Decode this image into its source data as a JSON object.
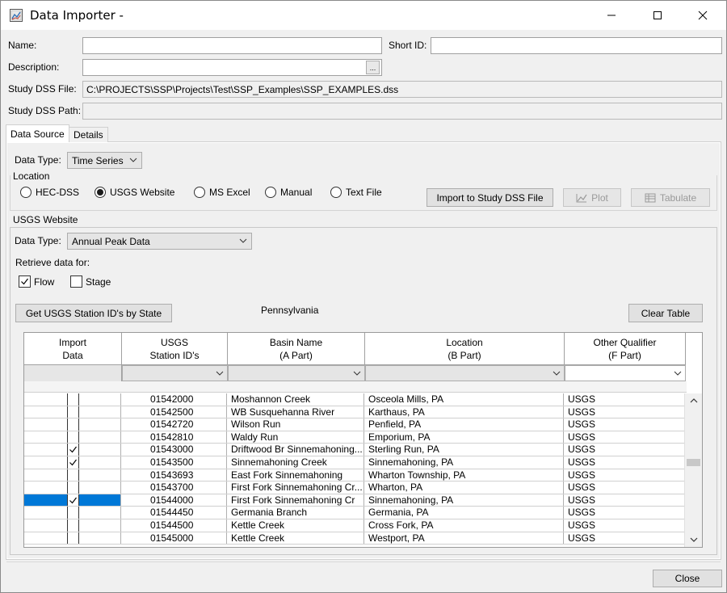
{
  "window": {
    "title": "Data Importer -"
  },
  "form": {
    "name_label": "Name:",
    "name_value": "",
    "short_id_label": "Short ID:",
    "short_id_value": "",
    "description_label": "Description:",
    "description_value": "",
    "browse_label": "...",
    "study_dss_file_label": "Study DSS File:",
    "study_dss_file_value": "C:\\PROJECTS\\SSP\\Projects\\Test\\SSP_Examples\\SSP_EXAMPLES.dss",
    "study_dss_path_label": "Study DSS Path:",
    "study_dss_path_value": ""
  },
  "tabs": [
    {
      "label": "Data Source",
      "selected": true
    },
    {
      "label": "Details",
      "selected": false
    }
  ],
  "data_source": {
    "data_type_label": "Data Type:",
    "data_type_value": "Time Series",
    "location_label": "Location",
    "radios": [
      {
        "label": "HEC-DSS",
        "selected": false
      },
      {
        "label": "USGS Website",
        "selected": true
      },
      {
        "label": "MS Excel",
        "selected": false
      },
      {
        "label": "Manual",
        "selected": false
      },
      {
        "label": "Text File",
        "selected": false
      }
    ],
    "import_button": "Import to Study DSS File",
    "plot_button": "Plot",
    "tabulate_button": "Tabulate"
  },
  "usgs": {
    "group_label": "USGS Website",
    "data_type_label": "Data Type:",
    "data_type_value": "Annual Peak Data",
    "retrieve_label": "Retrieve data for:",
    "flow_label": "Flow",
    "flow_checked": true,
    "stage_label": "Stage",
    "stage_checked": false,
    "get_stations_button": "Get USGS Station ID's by State",
    "state_value": "Pennsylvania",
    "clear_table_button": "Clear Table"
  },
  "table": {
    "headers": [
      {
        "line1": "Import",
        "line2": "Data"
      },
      {
        "line1": "USGS",
        "line2": "Station ID's"
      },
      {
        "line1": "Basin Name",
        "line2": "(A Part)"
      },
      {
        "line1": "Location",
        "line2": "(B Part)"
      },
      {
        "line1": "Other Qualifier",
        "line2": "(F Part)"
      }
    ],
    "rows": [
      {
        "import": false,
        "station": "01542000",
        "basin": "Moshannon Creek",
        "location": "Osceola Mills, PA",
        "qualifier": "USGS",
        "selected": false
      },
      {
        "import": false,
        "station": "01542500",
        "basin": "WB Susquehanna River",
        "location": "Karthaus, PA",
        "qualifier": "USGS",
        "selected": false
      },
      {
        "import": false,
        "station": "01542720",
        "basin": "Wilson Run",
        "location": "Penfield, PA",
        "qualifier": "USGS",
        "selected": false
      },
      {
        "import": false,
        "station": "01542810",
        "basin": "Waldy Run",
        "location": "Emporium, PA",
        "qualifier": "USGS",
        "selected": false
      },
      {
        "import": true,
        "station": "01543000",
        "basin": "Driftwood Br Sinnemahoning...",
        "location": "Sterling Run, PA",
        "qualifier": "USGS",
        "selected": false
      },
      {
        "import": true,
        "station": "01543500",
        "basin": "Sinnemahoning Creek",
        "location": "Sinnemahoning, PA",
        "qualifier": "USGS",
        "selected": false
      },
      {
        "import": false,
        "station": "01543693",
        "basin": "East Fork Sinnemahoning",
        "location": "Wharton Township, PA",
        "qualifier": "USGS",
        "selected": false
      },
      {
        "import": false,
        "station": "01543700",
        "basin": "First Fork Sinnemahoning Cr...",
        "location": "Wharton, PA",
        "qualifier": "USGS",
        "selected": false
      },
      {
        "import": true,
        "station": "01544000",
        "basin": "First Fork Sinnemahoning Cr",
        "location": "Sinnemahoning, PA",
        "qualifier": "USGS",
        "selected": true
      },
      {
        "import": false,
        "station": "01544450",
        "basin": "Germania Branch",
        "location": "Germania, PA",
        "qualifier": "USGS",
        "selected": false
      },
      {
        "import": false,
        "station": "01544500",
        "basin": "Kettle Creek",
        "location": "Cross Fork, PA",
        "qualifier": "USGS",
        "selected": false
      },
      {
        "import": false,
        "station": "01545000",
        "basin": "Kettle Creek",
        "location": "Westport, PA",
        "qualifier": "USGS",
        "selected": false
      }
    ]
  },
  "footer": {
    "close_button": "Close"
  },
  "colors": {
    "selection": "#0078d7",
    "window_bg": "#f0f0f0"
  }
}
